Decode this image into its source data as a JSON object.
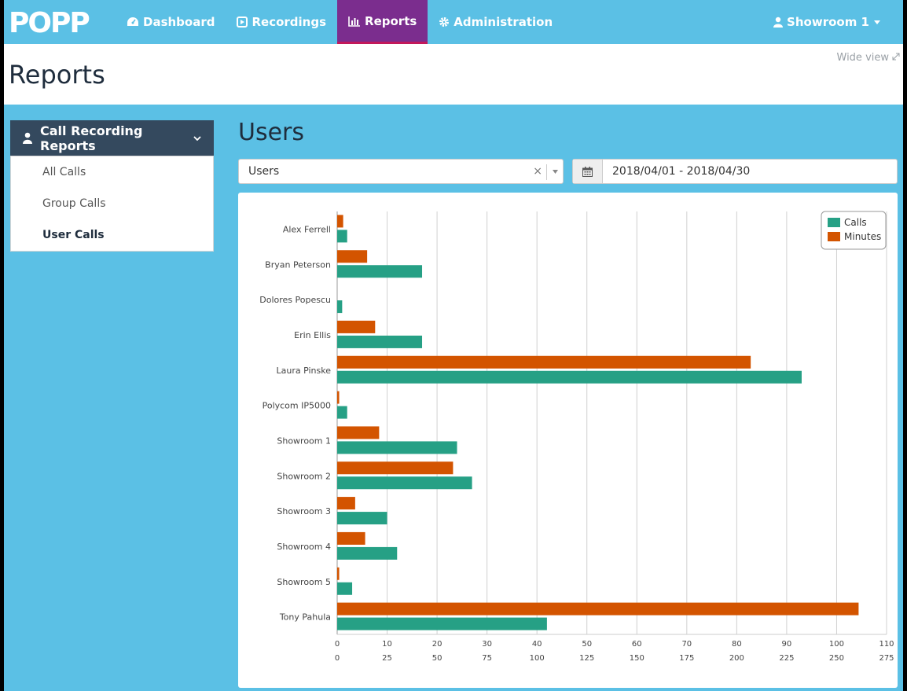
{
  "nav": {
    "logo_text": "POPP",
    "items": [
      {
        "label": "Dashboard",
        "icon": "dashboard-icon"
      },
      {
        "label": "Recordings",
        "icon": "play-icon"
      },
      {
        "label": "Reports",
        "icon": "bar-chart-icon",
        "active": true
      },
      {
        "label": "Administration",
        "icon": "gear-icon"
      }
    ],
    "user": "Showroom 1"
  },
  "header": {
    "title": "Reports",
    "wide_view": "Wide view"
  },
  "sidebar": {
    "title": "Call Recording Reports",
    "items": [
      {
        "label": "All Calls"
      },
      {
        "label": "Group Calls"
      },
      {
        "label": "User Calls",
        "active": true
      }
    ]
  },
  "main": {
    "title": "Users",
    "select_value": "Users",
    "date_range": "2018/04/01 - 2018/04/30"
  },
  "colors": {
    "calls": "#26a085",
    "minutes": "#d35400",
    "nav_bg": "#5bc0e5",
    "active_nav": "#7b2d8e",
    "sidebar_head": "#34495e"
  },
  "chart_data": {
    "type": "bar",
    "orientation": "horizontal",
    "categories": [
      "Alex Ferrell",
      "Bryan Peterson",
      "Dolores Popescu",
      "Erin Ellis",
      "Laura Pinske",
      "Polycom IP5000",
      "Showroom 1",
      "Showroom 2",
      "Showroom 3",
      "Showroom 4",
      "Showroom 5",
      "Tony Pahula"
    ],
    "series": [
      {
        "name": "Calls",
        "axis": "calls",
        "values": [
          2,
          17,
          1,
          17,
          93,
          2,
          24,
          27,
          10,
          12,
          3,
          42
        ]
      },
      {
        "name": "Minutes",
        "axis": "minutes",
        "values": [
          3,
          15,
          0,
          19,
          207,
          1,
          21,
          58,
          9,
          14,
          1,
          261
        ]
      }
    ],
    "axes": {
      "calls": {
        "min": 0,
        "max": 110,
        "ticks": [
          "0",
          "10",
          "20",
          "30",
          "40",
          "50",
          "60",
          "70",
          "80",
          "90",
          "100",
          "110"
        ]
      },
      "minutes": {
        "min": 0,
        "max": 275,
        "ticks": [
          "0",
          "25",
          "50",
          "75",
          "100",
          "125",
          "150",
          "175",
          "200",
          "225",
          "250",
          "275"
        ]
      }
    },
    "grid": true,
    "legend": "top-right"
  }
}
